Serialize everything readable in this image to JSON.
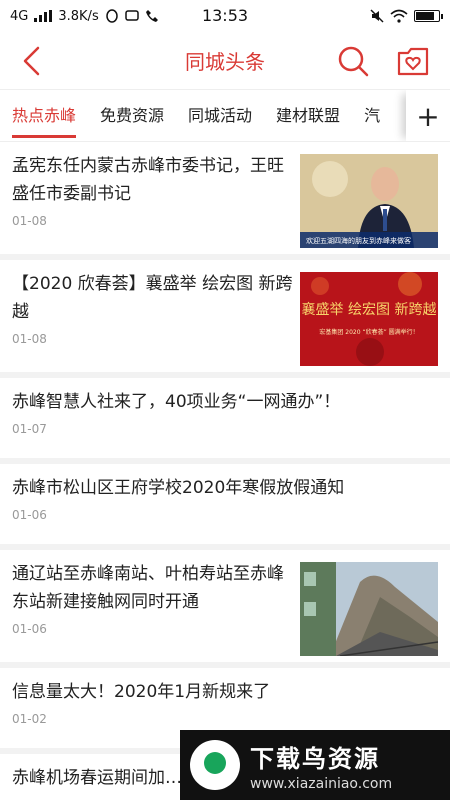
{
  "status": {
    "network": "4G",
    "speed": "3.8K/s",
    "time": "13:53"
  },
  "nav": {
    "title": "同城头条"
  },
  "tabs": [
    {
      "label": "热点赤峰",
      "active": true
    },
    {
      "label": "免费资源"
    },
    {
      "label": "同城活动"
    },
    {
      "label": "建材联盟"
    },
    {
      "label": "汽"
    }
  ],
  "tab_add": "+",
  "news": [
    {
      "title": "孟宪东任内蒙古赤峰市委书记，王旺盛任市委副书记",
      "date": "01-08",
      "thumb_caption": "欢迎五湖四海的朋友到赤峰来做客"
    },
    {
      "title": "【2020 欣春荟】襄盛举 绘宏图 新跨越",
      "date": "01-08",
      "thumb_text": "襄盛举  绘宏图  新跨越",
      "thumb_sub": "宏基集团 2020 “欣春荟” 圆满举行！"
    },
    {
      "title": "赤峰智慧人社来了，40项业务“一网通办”！",
      "date": "01-07"
    },
    {
      "title": "赤峰市松山区王府学校2020年寒假放假通知",
      "date": "01-06"
    },
    {
      "title": "通辽站至赤峰南站、叶柏寿站至赤峰东站新建接触网同时开通",
      "date": "01-06"
    },
    {
      "title": "信息量太大！2020年1月新规来了",
      "date": "01-02"
    },
    {
      "title": "赤峰机场春运期间加……特，北京方向航班……",
      "date": ""
    }
  ],
  "watermark": {
    "title": "下载鸟资源",
    "url": "www.xiazainiao.com"
  }
}
